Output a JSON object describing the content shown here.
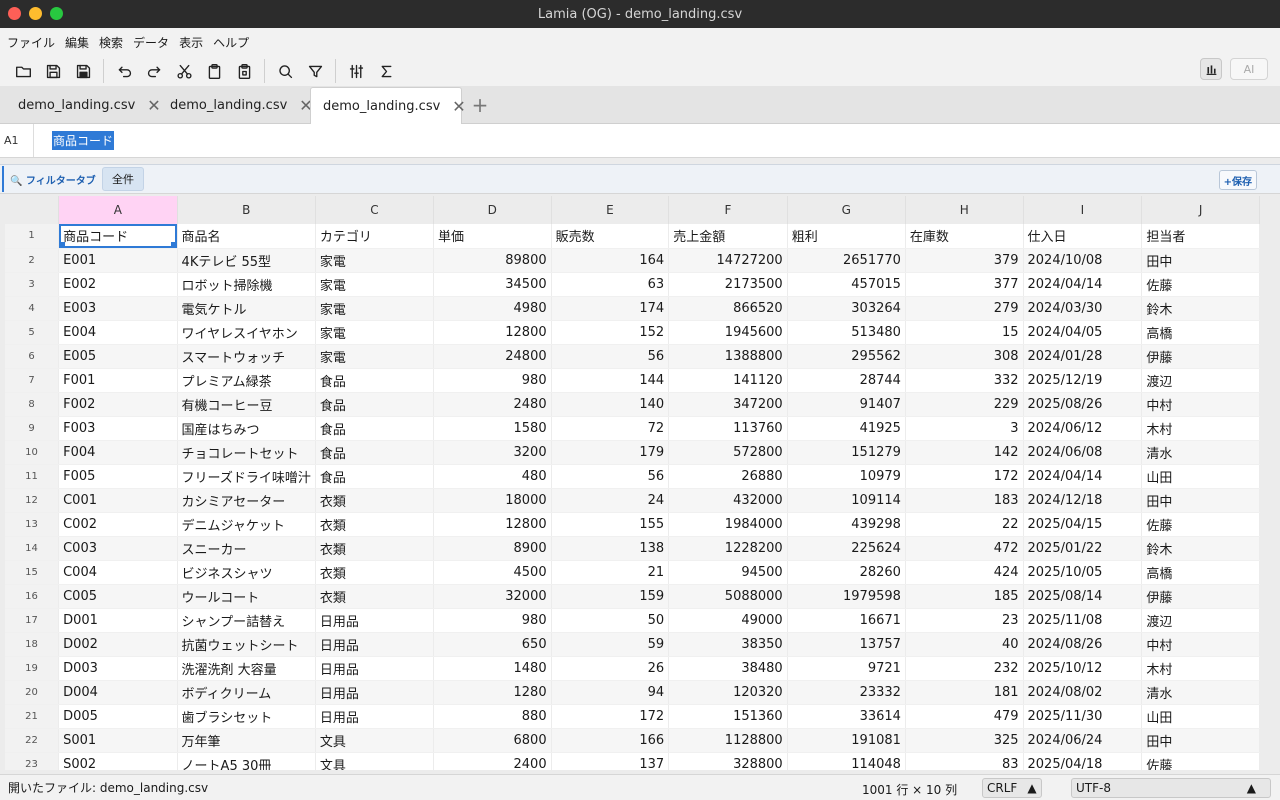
{
  "window": {
    "title": "Lamia (OG) - demo_landing.csv"
  },
  "menu": [
    "ファイル",
    "編集",
    "検索",
    "データ",
    "表示",
    "ヘルプ"
  ],
  "toolbar": {
    "ai_label": "AI"
  },
  "tabs": [
    {
      "label": "demo_landing.csv"
    },
    {
      "label": "demo_landing.csv"
    },
    {
      "label": "demo_landing.csv",
      "active": true
    }
  ],
  "tab_add": "+",
  "formula": {
    "ref": "A1",
    "value": "商品コード"
  },
  "filter": {
    "label": "🔍 フィルタータブ",
    "all": "全件",
    "save": "+保存"
  },
  "grid": {
    "columns": [
      "A",
      "B",
      "C",
      "D",
      "E",
      "F",
      "G",
      "H",
      "I",
      "J"
    ],
    "rows": [
      [
        "商品コード",
        "商品名",
        "カテゴリ",
        "単価",
        "販売数",
        "売上金額",
        "粗利",
        "在庫数",
        "仕入日",
        "担当者"
      ],
      [
        "E001",
        "4Kテレビ 55型",
        "家電",
        "89800",
        "164",
        "14727200",
        "2651770",
        "379",
        "2024/10/08",
        "田中"
      ],
      [
        "E002",
        "ロボット掃除機",
        "家電",
        "34500",
        "63",
        "2173500",
        "457015",
        "377",
        "2024/04/14",
        "佐藤"
      ],
      [
        "E003",
        "電気ケトル",
        "家電",
        "4980",
        "174",
        "866520",
        "303264",
        "279",
        "2024/03/30",
        "鈴木"
      ],
      [
        "E004",
        "ワイヤレスイヤホン",
        "家電",
        "12800",
        "152",
        "1945600",
        "513480",
        "15",
        "2024/04/05",
        "高橋"
      ],
      [
        "E005",
        "スマートウォッチ",
        "家電",
        "24800",
        "56",
        "1388800",
        "295562",
        "308",
        "2024/01/28",
        "伊藤"
      ],
      [
        "F001",
        "プレミアム緑茶",
        "食品",
        "980",
        "144",
        "141120",
        "28744",
        "332",
        "2025/12/19",
        "渡辺"
      ],
      [
        "F002",
        "有機コーヒー豆",
        "食品",
        "2480",
        "140",
        "347200",
        "91407",
        "229",
        "2025/08/26",
        "中村"
      ],
      [
        "F003",
        "国産はちみつ",
        "食品",
        "1580",
        "72",
        "113760",
        "41925",
        "3",
        "2024/06/12",
        "木村"
      ],
      [
        "F004",
        "チョコレートセット",
        "食品",
        "3200",
        "179",
        "572800",
        "151279",
        "142",
        "2024/06/08",
        "清水"
      ],
      [
        "F005",
        "フリーズドライ味噌汁",
        "食品",
        "480",
        "56",
        "26880",
        "10979",
        "172",
        "2024/04/14",
        "山田"
      ],
      [
        "C001",
        "カシミアセーター",
        "衣類",
        "18000",
        "24",
        "432000",
        "109114",
        "183",
        "2024/12/18",
        "田中"
      ],
      [
        "C002",
        "デニムジャケット",
        "衣類",
        "12800",
        "155",
        "1984000",
        "439298",
        "22",
        "2025/04/15",
        "佐藤"
      ],
      [
        "C003",
        "スニーカー",
        "衣類",
        "8900",
        "138",
        "1228200",
        "225624",
        "472",
        "2025/01/22",
        "鈴木"
      ],
      [
        "C004",
        "ビジネスシャツ",
        "衣類",
        "4500",
        "21",
        "94500",
        "28260",
        "424",
        "2025/10/05",
        "高橋"
      ],
      [
        "C005",
        "ウールコート",
        "衣類",
        "32000",
        "159",
        "5088000",
        "1979598",
        "185",
        "2025/08/14",
        "伊藤"
      ],
      [
        "D001",
        "シャンプー詰替え",
        "日用品",
        "980",
        "50",
        "49000",
        "16671",
        "23",
        "2025/11/08",
        "渡辺"
      ],
      [
        "D002",
        "抗菌ウェットシート",
        "日用品",
        "650",
        "59",
        "38350",
        "13757",
        "40",
        "2024/08/26",
        "中村"
      ],
      [
        "D003",
        "洗濯洗剤 大容量",
        "日用品",
        "1480",
        "26",
        "38480",
        "9721",
        "232",
        "2025/10/12",
        "木村"
      ],
      [
        "D004",
        "ボディクリーム",
        "日用品",
        "1280",
        "94",
        "120320",
        "23332",
        "181",
        "2024/08/02",
        "清水"
      ],
      [
        "D005",
        "歯ブラシセット",
        "日用品",
        "880",
        "172",
        "151360",
        "33614",
        "479",
        "2025/11/30",
        "山田"
      ],
      [
        "S001",
        "万年筆",
        "文具",
        "6800",
        "166",
        "1128800",
        "191081",
        "325",
        "2024/06/24",
        "田中"
      ],
      [
        "S002",
        "ノートA5 30冊",
        "文具",
        "2400",
        "137",
        "328800",
        "114048",
        "83",
        "2025/04/18",
        "佐藤"
      ]
    ]
  },
  "status": {
    "file": "開いたファイル: demo_landing.csv",
    "rowcol": "1001 行 × 10 列",
    "eol": "CRLF",
    "encoding": "UTF-8"
  }
}
